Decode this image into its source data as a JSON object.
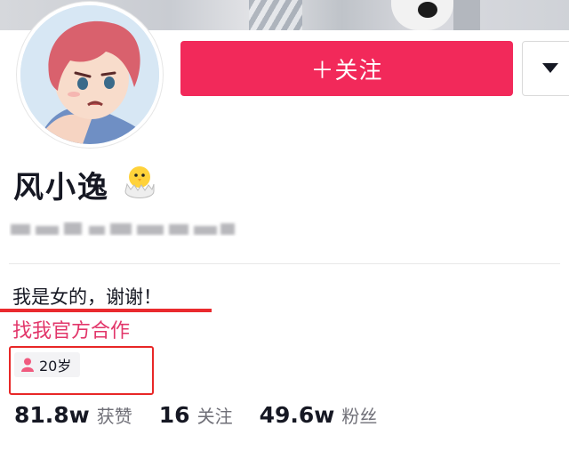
{
  "profile": {
    "name": "风小逸",
    "follow_label": "＋关注",
    "bio": "我是女的，谢谢！",
    "business_link": "找我官方合作",
    "age": "20岁"
  },
  "stats": [
    {
      "value": "81.8w",
      "label": "获赞"
    },
    {
      "value": "16",
      "label": "关注"
    },
    {
      "value": "49.6w",
      "label": "粉丝"
    }
  ],
  "icons": {
    "name_badge": "hatching-chick-icon",
    "more": "triangle-down-icon",
    "age": "person-icon"
  },
  "colors": {
    "accent": "#f2295a",
    "link": "#e2366a",
    "annotation": "#e82727"
  }
}
